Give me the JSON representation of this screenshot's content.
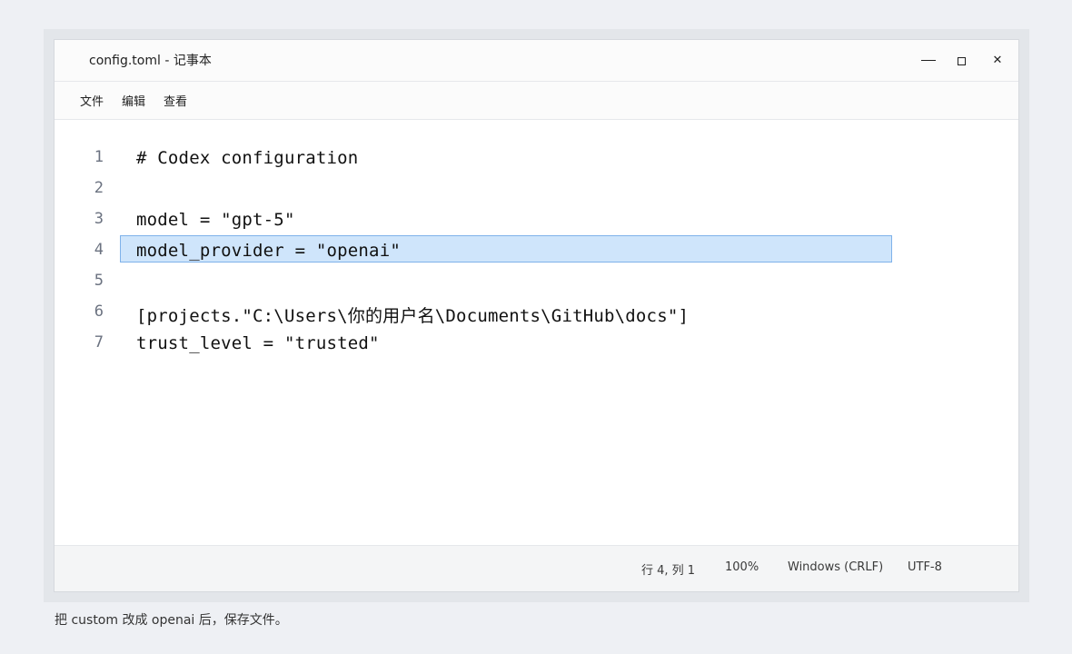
{
  "window": {
    "title": "config.toml - 记事本"
  },
  "menu": {
    "items": [
      "文件",
      "编辑",
      "查看"
    ]
  },
  "editor": {
    "lines": [
      {
        "num": "1",
        "text": "# Codex configuration"
      },
      {
        "num": "2",
        "text": ""
      },
      {
        "num": "3",
        "text": "model = \"gpt-5\""
      },
      {
        "num": "4",
        "text": "model_provider = \"openai\""
      },
      {
        "num": "5",
        "text": ""
      },
      {
        "num": "6",
        "text": "[projects.\"C:\\Users\\你的用户名\\Documents\\GitHub\\docs\"]"
      },
      {
        "num": "7",
        "text": "trust_level = \"trusted\""
      }
    ],
    "highlighted_line": 4
  },
  "status": {
    "position": "行 4, 列 1",
    "zoom": "100%",
    "line_ending": "Windows (CRLF)",
    "encoding": "UTF-8"
  },
  "caption": "把 custom 改成 openai 后，保存文件。",
  "colors": {
    "highlight_fill": "#cfe5fb",
    "highlight_border": "#7fb2ea"
  },
  "icons": {
    "minimize": "minimize-icon",
    "maximize": "maximize-icon",
    "close": "close-icon"
  }
}
